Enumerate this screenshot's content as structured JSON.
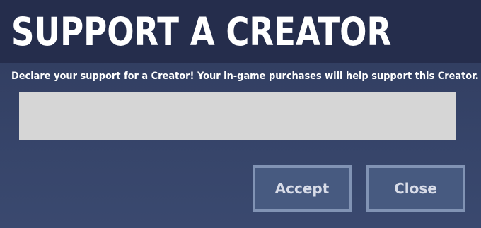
{
  "header": {
    "title": "SUPPORT A CREATOR"
  },
  "body": {
    "description": "Declare your support for a Creator! Your in-game purchases will help support this Creator."
  },
  "creator_input": {
    "value": "",
    "placeholder": ""
  },
  "buttons": {
    "accept_label": "Accept",
    "close_label": "Close"
  },
  "colors": {
    "header_bg": "#252d4c",
    "panel_bg": "#364469",
    "input_bg": "#d6d6d6",
    "button_bg": "#475a80",
    "button_border": "#8193b4",
    "text": "#ffffff"
  }
}
